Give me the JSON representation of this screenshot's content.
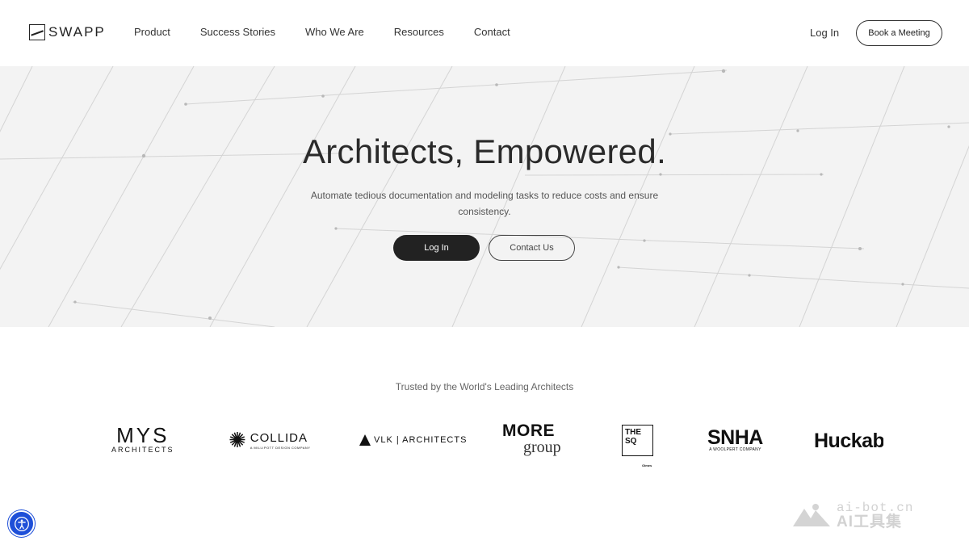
{
  "header": {
    "logo_text": "SWAPP",
    "nav": [
      "Product",
      "Success Stories",
      "Who We Are",
      "Resources",
      "Contact"
    ],
    "login_label": "Log In",
    "book_label": "Book a Meeting"
  },
  "hero": {
    "title": "Architects, Empowered.",
    "subtitle": "Automate tedious documentation and modeling tasks to reduce costs and ensure consistency.",
    "login_label": "Log In",
    "contact_label": "Contact Us",
    "background_color": "#f3f3f3"
  },
  "trusted": {
    "heading": "Trusted by the World's Leading Architects",
    "logos": {
      "mys_main": "MYS",
      "mys_sub": "ARCHITECTS",
      "collida": "COLLIDA",
      "collida_sub": "A MILLIPOTT DESIGN COMPANY",
      "vlk": "VLK | ARCHITECTS",
      "more_1": "MORE",
      "more_2": "group",
      "thesq": "THE SQ",
      "thesq_sub": "Olmes",
      "snha_main": "SNHA",
      "snha_sub": "A WOOLPERT COMPANY",
      "huckabee": "Huckabee"
    }
  },
  "watermark": {
    "line1": "ai-bot.cn",
    "line2": "AI工具集"
  },
  "colors": {
    "accent_dark": "#222222",
    "accessibility_blue": "#1e4fd8"
  }
}
